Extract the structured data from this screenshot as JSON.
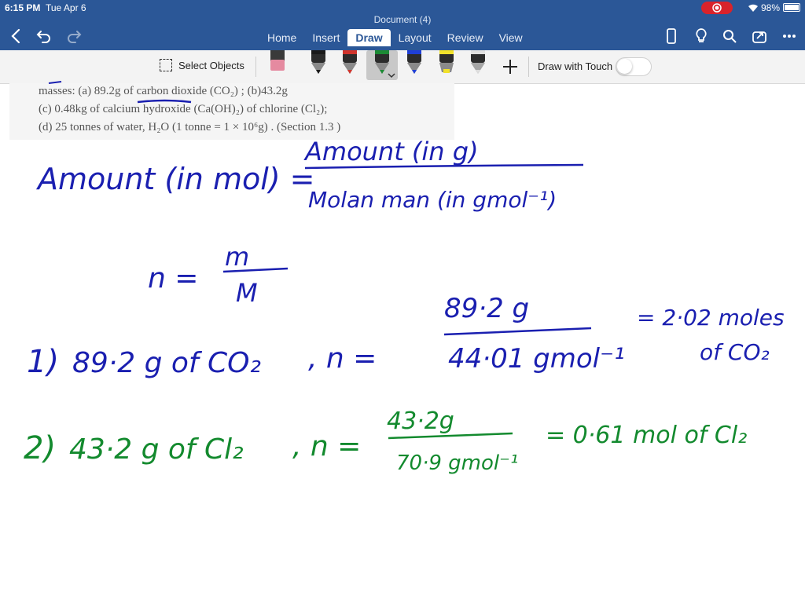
{
  "status": {
    "time": "6:15 PM",
    "date": "Tue Apr 6",
    "battery": "98%"
  },
  "header": {
    "doc_title": "Document (4)",
    "tabs": [
      {
        "label": "Home",
        "active": false
      },
      {
        "label": "Insert",
        "active": false
      },
      {
        "label": "Draw",
        "active": true
      },
      {
        "label": "Layout",
        "active": false
      },
      {
        "label": "Review",
        "active": false
      },
      {
        "label": "View",
        "active": false
      }
    ],
    "icons": [
      "back-icon",
      "undo-icon",
      "redo-icon",
      "phone-icon",
      "lightbulb-icon",
      "search-icon",
      "share-icon",
      "more-icon"
    ]
  },
  "toolbar": {
    "select_objects": "Select Objects",
    "draw_with_touch": "Draw with Touch",
    "pens": [
      {
        "name": "eraser",
        "color": "#e58aa0"
      },
      {
        "name": "black-pen",
        "color": "#1a1a1a"
      },
      {
        "name": "red-pen",
        "color": "#d0342c"
      },
      {
        "name": "green-pen",
        "color": "#1c8a34",
        "selected": true
      },
      {
        "name": "blue-pen",
        "color": "#1f3fd6"
      },
      {
        "name": "yellow-highlighter",
        "color": "#f1e12a"
      },
      {
        "name": "silver-pen",
        "color": "#d6d6d6"
      }
    ]
  },
  "textbook": {
    "line1": "masses: (a) 89.2g of carbon dioxide (CO₂) ; (b)43.2g",
    "line2": "(c) 0.48kg of calcium hydroxide (Ca(OH)₂) of chlorine (Cl₂);",
    "line3": "(d) 25 tonnes of water, H₂O (1 tonne = 1 × 10⁶g) . (Section 1.3 )"
  },
  "notes": {
    "formula_lhs": "Amount (in mol) =",
    "formula_num": "Amount (in g)",
    "formula_den": "Molan man (in gmol⁻¹)",
    "n_lhs": "n =",
    "n_num": "m",
    "n_den": "M",
    "q1_label": "1)",
    "q1_given": "89·2 g of CO₂",
    "q1_n": ", n =",
    "q1_num": "89·2 g",
    "q1_den": "44·01 gmol⁻¹",
    "q1_result": "= 2·02 moles",
    "q1_result2": "of CO₂",
    "q2_label": "2)",
    "q2_given": "43·2 g of Cl₂",
    "q2_n": ", n =",
    "q2_num": "43·2g",
    "q2_den": "70·9 gmol⁻¹",
    "q2_result": "= 0·61 mol of Cl₂"
  },
  "colors": {
    "header": "#2b5797",
    "ink_blue": "#1a1fb0",
    "ink_green": "#138a2e"
  }
}
